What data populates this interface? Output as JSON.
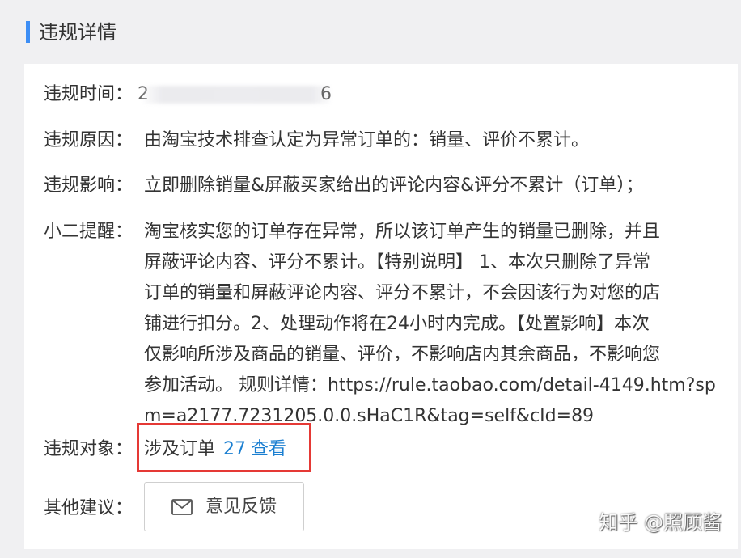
{
  "header": {
    "title": "违规详情",
    "accent_color": "#3d8ef5"
  },
  "details": {
    "time": {
      "label": "违规时间：",
      "value_left": "2",
      "value_right": "6"
    },
    "reason": {
      "label": "违规原因：",
      "value": "由淘宝技术排查认定为异常订单的：销量、评价不累计。"
    },
    "impact": {
      "label": "违规影响：",
      "value": "立即删除销量&屏蔽买家给出的评论内容&评分不累计（订单）；"
    },
    "reminder": {
      "label": "小二提醒：",
      "lines": [
        "淘宝核实您的订单存在异常，所以该订单产生的销量已删除，并且",
        "屏蔽评论内容、评分不累计。【特别说明】 1、本次只删除了异常",
        "订单的销量和屏蔽评论内容、评分不累计，不会因该行为对您的店",
        "铺进行扣分。2、处理动作将在24小时内完成。【处置影响】本次",
        "仅影响所涉及商品的销量、评价，不影响店内其余商品，不影响您",
        "参加活动。 规则详情：https://rule.taobao.com/detail-4149.htm?sp",
        "m=a2177.7231205.0.0.sHaC1R&tag=self&cId=89"
      ]
    },
    "target": {
      "label": "违规对象：",
      "text": "涉及订单",
      "count": "27",
      "link": "查看",
      "highlight_color": "#e53935",
      "link_color": "#1b7fd1"
    },
    "suggestion": {
      "label": "其他建议：",
      "button": "意见反馈",
      "icon": "mail-icon"
    }
  },
  "watermark": "知乎 @照顾酱"
}
